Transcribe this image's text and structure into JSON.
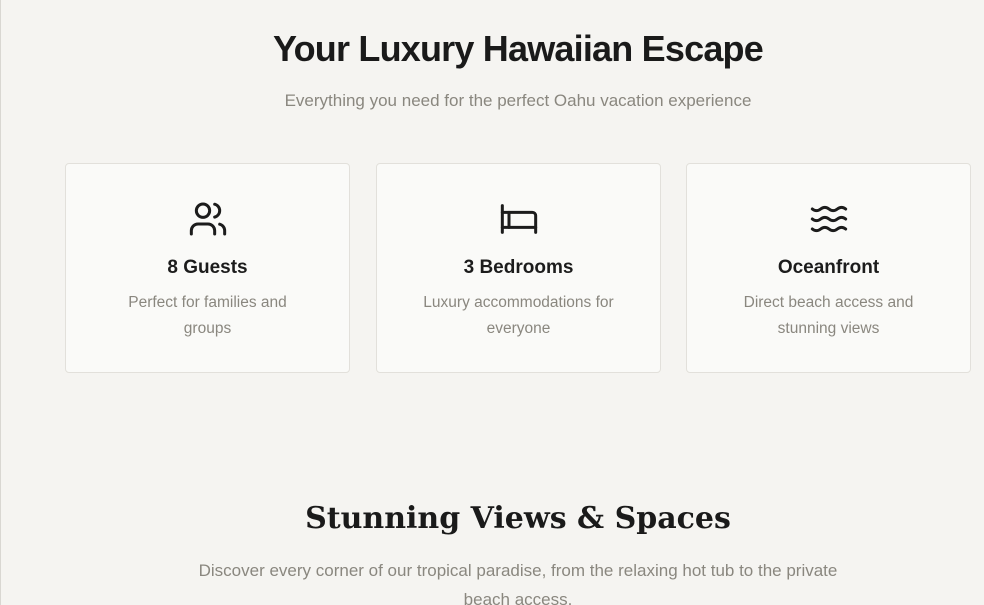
{
  "hero": {
    "title": "Your Luxury Hawaiian Escape",
    "subtitle": "Everything you need for the perfect Oahu vacation experience"
  },
  "features": [
    {
      "icon": "users-icon",
      "title": "8 Guests",
      "description": "Perfect for families and groups"
    },
    {
      "icon": "bed-icon",
      "title": "3 Bedrooms",
      "description": "Luxury accommodations for everyone"
    },
    {
      "icon": "waves-icon",
      "title": "Oceanfront",
      "description": "Direct beach access and stunning views"
    }
  ],
  "gallery": {
    "title": "Stunning Views & Spaces",
    "subtitle": "Discover every corner of our tropical paradise, from the relaxing hot tub to the private beach access."
  }
}
